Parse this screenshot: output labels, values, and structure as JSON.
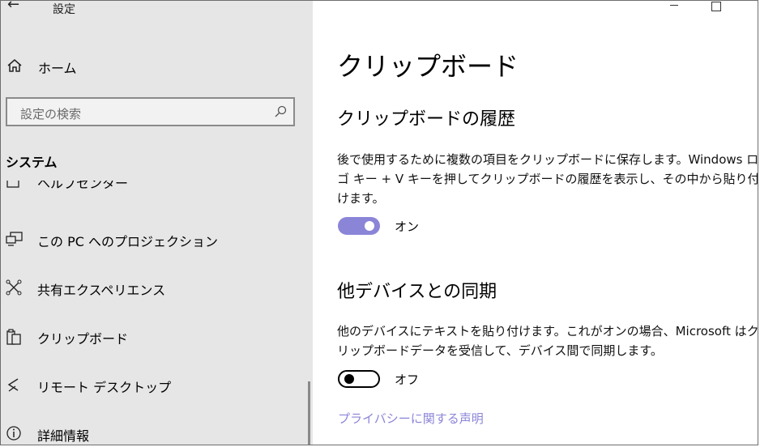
{
  "app": {
    "title": "設定",
    "back_icon": "←"
  },
  "sidebar": {
    "home_label": "ホーム",
    "search_placeholder": "設定の検索",
    "section": "システム",
    "partial_item": "ヘルプセンター",
    "items": [
      {
        "label": "この PC へのプロジェクション",
        "icon": "projection-icon"
      },
      {
        "label": "共有エクスペリエンス",
        "icon": "shared-experiences-icon"
      },
      {
        "label": "クリップボード",
        "icon": "clipboard-icon"
      },
      {
        "label": "リモート デスクトップ",
        "icon": "remote-desktop-icon"
      },
      {
        "label": "詳細情報",
        "icon": "info-icon"
      }
    ]
  },
  "main": {
    "title": "クリップボード",
    "history": {
      "heading": "クリップボードの履歴",
      "description": "後で使用するために複数の項目をクリップボードに保存します。Windows ロゴ キー + V キーを押してクリップボードの履歴を表示し、その中から貼り付けます。",
      "toggle_state": "オン",
      "toggle_on": true
    },
    "sync": {
      "heading": "他デバイスとの同期",
      "description": "他のデバイスにテキストを貼り付けます。これがオンの場合、Microsoft はクリップボードデータを受信して、デバイス間で同期します。",
      "toggle_state": "オフ",
      "toggle_on": false
    },
    "privacy_link": "プライバシーに関する声明"
  },
  "colors": {
    "accent": "#8b85d8",
    "sidebar_bg": "#e6e6e6"
  }
}
